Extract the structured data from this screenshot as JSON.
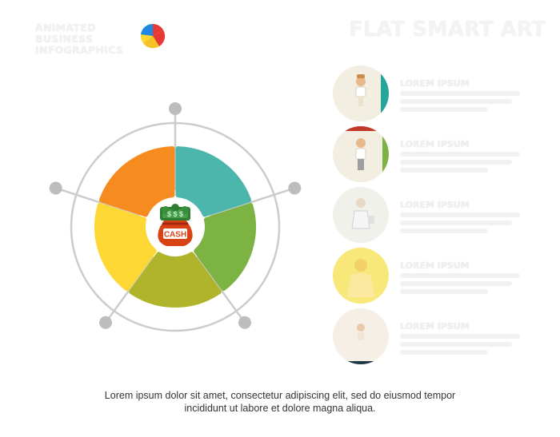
{
  "header": {
    "brand_line1": "ANIMATED BUSINESS",
    "brand_line2": "INFOGRAPHICS",
    "brand_logo": "pie-logo-icon",
    "title": "FLAT SMART ART"
  },
  "diagram": {
    "center_badge_text": "CASH",
    "center_icon": "money-bag-icon",
    "segments": [
      {
        "name": "orange",
        "color": "#F68B1F"
      },
      {
        "name": "teal",
        "color": "#4DB6AC"
      },
      {
        "name": "green",
        "color": "#7CB342"
      },
      {
        "name": "olive",
        "color": "#AFB42B"
      },
      {
        "name": "yellow",
        "color": "#FDD835"
      }
    ],
    "ring_color": "#CCCCCC",
    "node_color": "#BDBDBD"
  },
  "people": [
    {
      "heading": "LOREM IPSUM",
      "accent": "#26A69A",
      "bg": "#F3EEE2"
    },
    {
      "heading": "LOREM IPSUM",
      "accent": "#C0392B",
      "bg": "#F3EEE2"
    },
    {
      "heading": "LOREM IPSUM",
      "accent": "#9E9E9E",
      "bg": "#F1F1EC"
    },
    {
      "heading": "LOREM IPSUM",
      "accent": "#FDD835",
      "bg": "#F8E87A"
    },
    {
      "heading": "LOREM IPSUM",
      "accent": "#C4C1B6",
      "bg": "#F6EFE6"
    }
  ],
  "footer": {
    "line1": "Lorem ipsum dolor sit amet, consectetur adipiscing elit, sed do eiusmod tempor",
    "line2": "incididunt ut labore et dolore magna aliqua."
  }
}
